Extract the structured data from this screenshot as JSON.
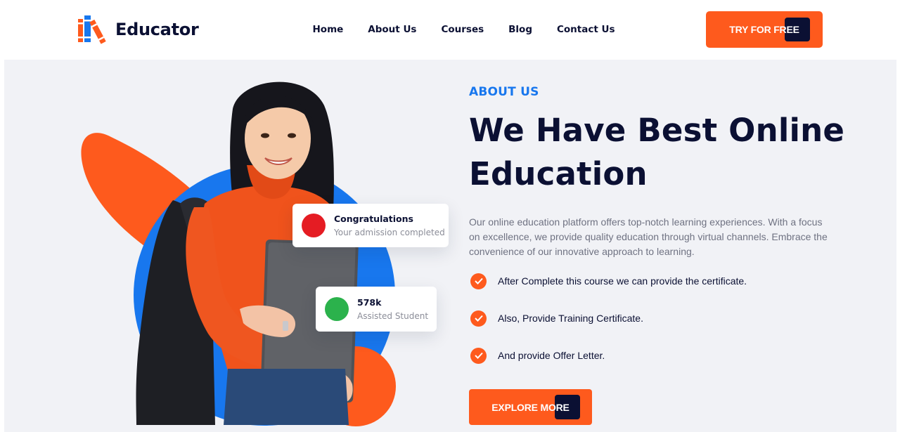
{
  "header": {
    "logo_text": "Educator",
    "logo_icon": "books-icon",
    "nav": [
      {
        "label": "Home"
      },
      {
        "label": "About Us"
      },
      {
        "label": "Courses"
      },
      {
        "label": "Blog"
      },
      {
        "label": "Contact Us"
      }
    ],
    "cta_label": "TRY FOR FREE"
  },
  "about": {
    "kicker": "ABOUT US",
    "headline_line1": "We Have Best Online",
    "headline_line2": "Education",
    "paragraph": "Our online education platform offers top-notch learning experiences. With a focus on excellence, we provide quality education through virtual channels. Embrace the convenience of our innovative approach to learning.",
    "checklist": [
      {
        "label": "After Complete this course we can provide the certificate."
      },
      {
        "label": "Also, Provide Training Certificate."
      },
      {
        "label": "And provide Offer Letter."
      }
    ],
    "explore_label": "EXPLORE MORE"
  },
  "cards": {
    "congrats_title": "Congratulations",
    "congrats_sub": "Your admission completed",
    "students_count": "578k",
    "students_sub": "Assisted Student"
  },
  "colors": {
    "accent": "#fe5a1d",
    "navy": "#0b1033",
    "blue": "#1877ee",
    "background": "#f1f2f6"
  }
}
